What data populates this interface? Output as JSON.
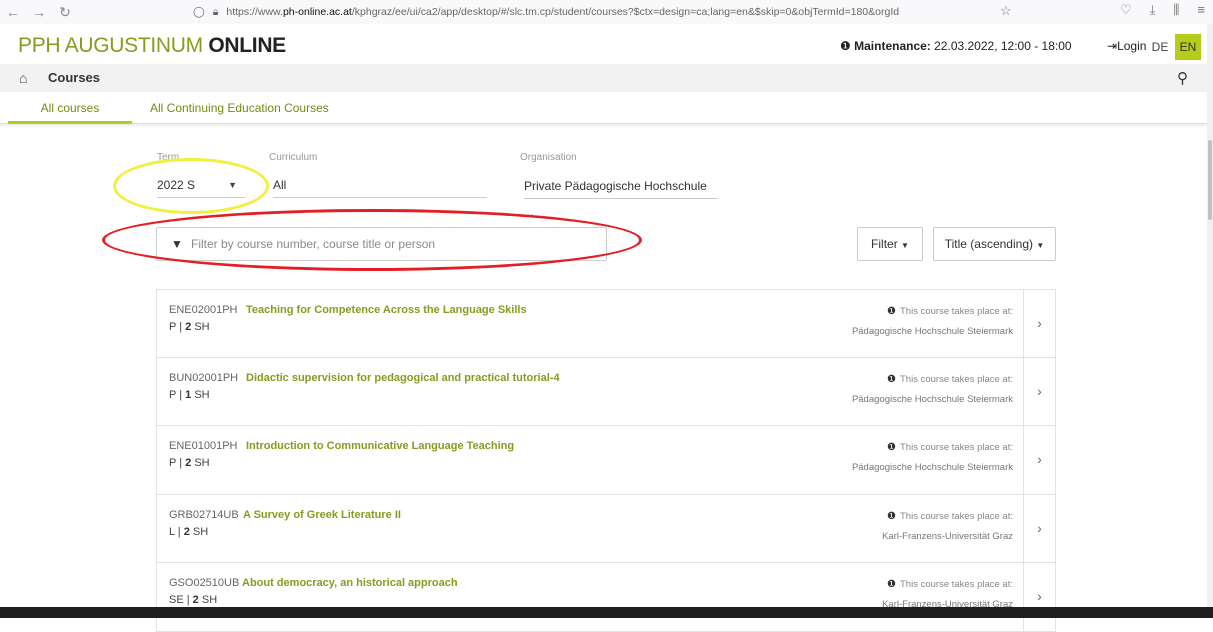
{
  "browser": {
    "url_host": "ph-online.ac.at",
    "url_prefix": "https://www.",
    "url_rest": "/kphgraz/ee/ui/ca2/app/desktop/#/slc.tm.cp/student/courses?$ctx=design=ca;lang=en&$skip=0&objTermId=180&orgId"
  },
  "header": {
    "logo_part1": "PPH AUGUSTINUM ",
    "logo_part2": "ONLINE",
    "maintenance_label": "Maintenance:",
    "maintenance_value": " 22.03.2022, 12:00 - 18:00",
    "login_label": "Login",
    "lang_de": "DE",
    "lang_en": "EN",
    "accent_color": "#b5cc18"
  },
  "breadcrumb": {
    "title": "Courses"
  },
  "tabs": [
    {
      "label": "All courses",
      "active": true
    },
    {
      "label": "All Continuing Education Courses",
      "active": false
    }
  ],
  "filters": {
    "term_label": "Term",
    "term_value": "2022 S",
    "curriculum_label": "Curriculum",
    "curriculum_value": "All",
    "organisation_label": "Organisation",
    "organisation_value": "Private Pädagogische Hochschule ...",
    "search_placeholder": "Filter by course number, course title or person",
    "filter_button": "Filter",
    "sort_button": "Title (ascending)"
  },
  "place_label": "This course takes place at:",
  "courses": [
    {
      "code": "ENE02001PH",
      "title": "Teaching for Competence Across the Language Skills",
      "type": "P",
      "sh": "2",
      "sh_unit": "SH",
      "place": "Pädagogische Hochschule Steiermark"
    },
    {
      "code": "BUN02001PH",
      "title": "Didactic supervision for pedagogical and practical tutorial-4",
      "type": "P",
      "sh": "1",
      "sh_unit": "SH",
      "place": "Pädagogische Hochschule Steiermark"
    },
    {
      "code": "ENE01001PH",
      "title": "Introduction to Communicative Language Teaching",
      "type": "P",
      "sh": "2",
      "sh_unit": "SH",
      "place": "Pädagogische Hochschule Steiermark"
    },
    {
      "code": "GRB02714UB",
      "title": "A Survey of Greek Literature II",
      "type": "L",
      "sh": "2",
      "sh_unit": "SH",
      "place": "Karl-Franzens-Universität Graz"
    },
    {
      "code": "GSO02510UB",
      "title": "About democracy, an historical approach",
      "type": "SE",
      "sh": "2",
      "sh_unit": "SH",
      "place": "Karl-Franzens-Universität Graz"
    }
  ]
}
